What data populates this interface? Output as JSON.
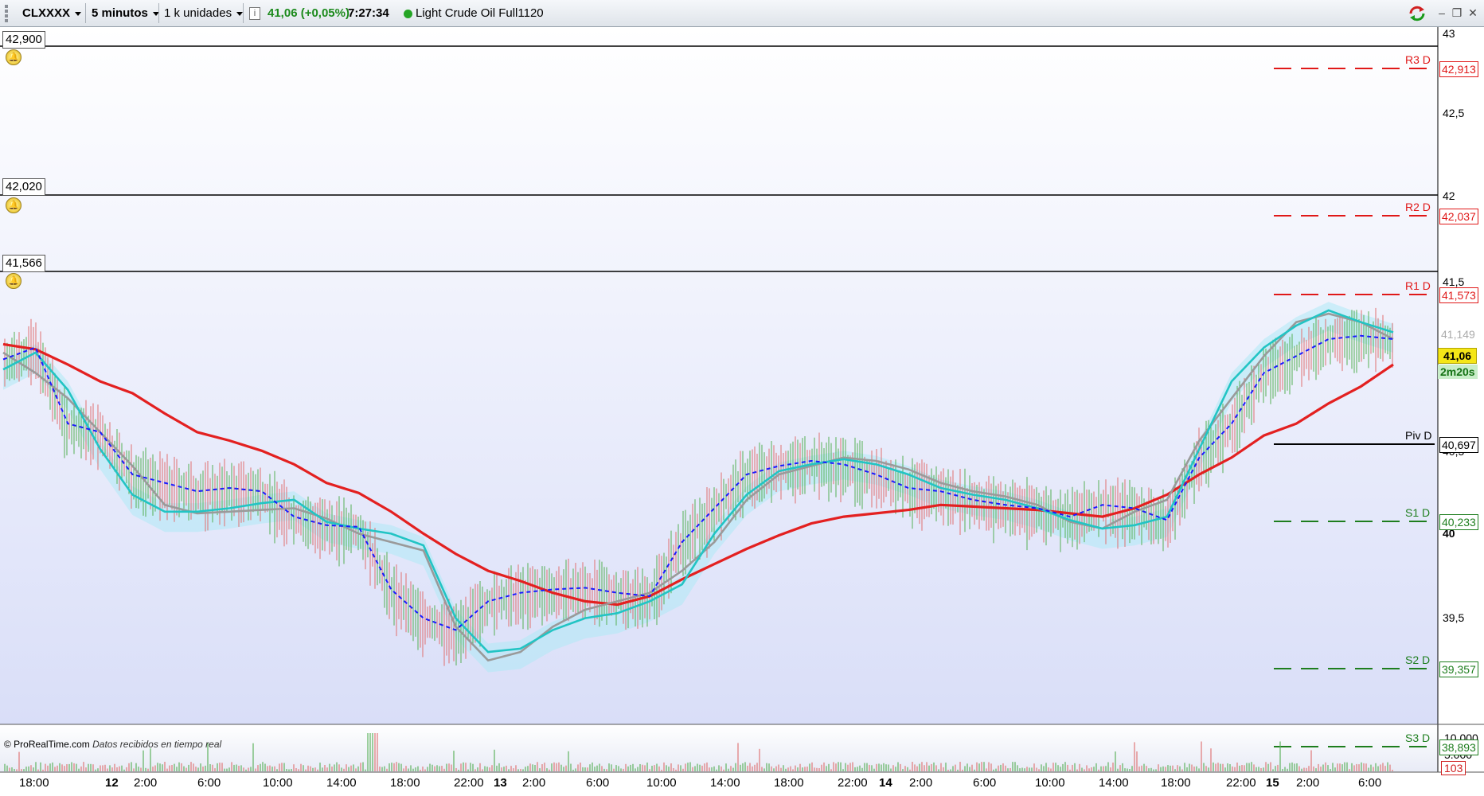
{
  "toolbar": {
    "symbol": "CLXXXX",
    "interval": "5 minutos",
    "units": "1 k unidades",
    "info_icon": "info-icon",
    "last_price_change": "41,06 (+0,05%)",
    "time": "7:27:34",
    "status_color": "#25a525",
    "instrument_name": "Light Crude Oil Full1120",
    "window_buttons": [
      "minimize-icon",
      "restore-icon",
      "close-icon"
    ]
  },
  "alerts": {
    "line_labels": [
      "42,900",
      "42,020",
      "41,566"
    ],
    "bell_icon": "bell-icon"
  },
  "pivot_levels": [
    {
      "name": "R3 D",
      "value": "42,913",
      "color": "#e01818"
    },
    {
      "name": "R2 D",
      "value": "42,037",
      "color": "#e01818"
    },
    {
      "name": "R1 D",
      "value": "41,573",
      "color": "#e01818"
    },
    {
      "name": "Piv D",
      "value": "40,697",
      "color": "#000000"
    },
    {
      "name": "S1 D",
      "value": "40,233",
      "color": "#1e7e1e"
    },
    {
      "name": "S2 D",
      "value": "39,357",
      "color": "#1e7e1e"
    },
    {
      "name": "S3 D",
      "value": "38,893",
      "color": "#1e7e1e"
    }
  ],
  "price_axis": {
    "ticks": [
      "43",
      "42,5",
      "42",
      "41,5",
      "40,5",
      "40",
      "39,5"
    ],
    "current_price": "41,06",
    "countdown": "2m20s",
    "ma_value": "41,149"
  },
  "volume_axis": {
    "ticks": [
      "10.000",
      "5.000"
    ],
    "current_volume": "103"
  },
  "time_axis": [
    {
      "label": "18:00",
      "bold": false
    },
    {
      "label": "12",
      "bold": true
    },
    {
      "label": "2:00",
      "bold": false
    },
    {
      "label": "6:00",
      "bold": false
    },
    {
      "label": "10:00",
      "bold": false
    },
    {
      "label": "14:00",
      "bold": false
    },
    {
      "label": "18:00",
      "bold": false
    },
    {
      "label": "22:00",
      "bold": false
    },
    {
      "label": "13",
      "bold": true
    },
    {
      "label": "2:00",
      "bold": false
    },
    {
      "label": "6:00",
      "bold": false
    },
    {
      "label": "10:00",
      "bold": false
    },
    {
      "label": "14:00",
      "bold": false
    },
    {
      "label": "18:00",
      "bold": false
    },
    {
      "label": "22:00",
      "bold": false
    },
    {
      "label": "14",
      "bold": true
    },
    {
      "label": "2:00",
      "bold": false
    },
    {
      "label": "6:00",
      "bold": false
    },
    {
      "label": "10:00",
      "bold": false
    },
    {
      "label": "14:00",
      "bold": false
    },
    {
      "label": "18:00",
      "bold": false
    },
    {
      "label": "22:00",
      "bold": false
    },
    {
      "label": "15",
      "bold": true
    },
    {
      "label": "2:00",
      "bold": false
    },
    {
      "label": "6:00",
      "bold": false
    }
  ],
  "footer": {
    "source": "© ProRealTime.com",
    "note": "Datos recibidos en tiempo real"
  },
  "chart_data": {
    "type": "line",
    "ylim": [
      38.7,
      43.05
    ],
    "series": [
      {
        "color": "#e32020",
        "values": [
          41.07,
          41.04,
          40.95,
          40.85,
          40.78,
          40.66,
          40.55,
          40.5,
          40.44,
          40.36,
          40.25,
          40.19,
          40.08,
          39.95,
          39.83,
          39.73,
          39.67,
          39.6,
          39.55,
          39.53,
          39.58,
          39.68,
          39.77,
          39.86,
          39.94,
          40.01,
          40.05,
          40.07,
          40.09,
          40.12,
          40.11,
          40.1,
          40.09,
          40.07,
          40.05,
          40.1,
          40.18,
          40.3,
          40.4,
          40.53,
          40.6,
          40.72,
          40.82,
          40.95
        ]
      },
      {
        "color": "#9a9a9a",
        "values": [
          41.02,
          40.9,
          40.75,
          40.55,
          40.35,
          40.12,
          40.07,
          40.08,
          40.09,
          40.1,
          40.04,
          39.95,
          39.9,
          39.85,
          39.4,
          39.2,
          39.25,
          39.4,
          39.5,
          39.55,
          39.6,
          39.73,
          39.9,
          40.15,
          40.3,
          40.35,
          40.4,
          40.38,
          40.33,
          40.25,
          40.2,
          40.17,
          40.12,
          40.02,
          39.98,
          40.08,
          40.15,
          40.5,
          40.75,
          41.0,
          41.2,
          41.25,
          41.2,
          41.1
        ]
      },
      {
        "color": "#22c4c4",
        "values": [
          40.92,
          41.02,
          40.8,
          40.45,
          40.18,
          40.08,
          40.08,
          40.1,
          40.13,
          40.15,
          40.02,
          39.98,
          39.95,
          39.88,
          39.45,
          39.25,
          39.27,
          39.38,
          39.45,
          39.48,
          39.55,
          39.65,
          39.95,
          40.18,
          40.32,
          40.36,
          40.39,
          40.36,
          40.3,
          40.22,
          40.18,
          40.15,
          40.1,
          40.03,
          39.98,
          40.0,
          40.05,
          40.45,
          40.85,
          41.05,
          41.18,
          41.27,
          41.2,
          41.14
        ]
      },
      {
        "color": "#1a1aff",
        "values": [
          40.98,
          41.05,
          40.6,
          40.55,
          40.3,
          40.25,
          40.2,
          40.22,
          40.2,
          40.05,
          40.0,
          39.99,
          39.62,
          39.45,
          39.38,
          39.55,
          39.6,
          39.62,
          39.63,
          39.6,
          39.58,
          39.9,
          40.1,
          40.3,
          40.35,
          40.38,
          40.36,
          40.3,
          40.22,
          40.2,
          40.15,
          40.12,
          40.1,
          40.05,
          40.12,
          40.1,
          40.03,
          40.4,
          40.6,
          40.9,
          41.0,
          41.1,
          41.12,
          41.1
        ]
      }
    ]
  }
}
